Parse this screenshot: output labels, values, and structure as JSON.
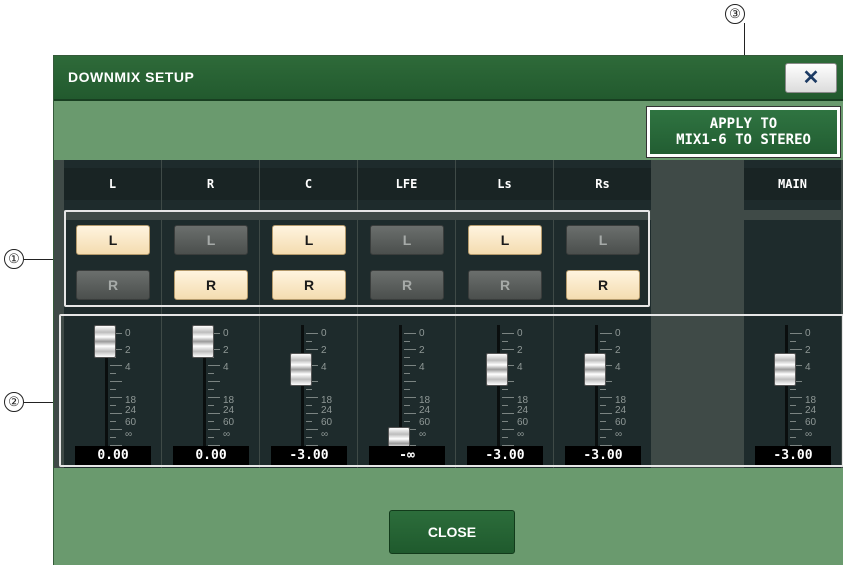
{
  "callouts": [
    "①",
    "②",
    "③"
  ],
  "window": {
    "title": "DOWNMIX SETUP",
    "close_icon": "✕",
    "apply_button": {
      "line1": "APPLY TO",
      "line2": "MIX1-6 TO STEREO"
    },
    "close_button": "CLOSE"
  },
  "scale_labels": [
    "0",
    "2",
    "4",
    "18",
    "24",
    "60",
    "∞"
  ],
  "channels": [
    {
      "name": "L",
      "l": "L",
      "r": "R",
      "l_on": true,
      "r_on": false,
      "value": "0.00",
      "level_db": "0"
    },
    {
      "name": "R",
      "l": "L",
      "r": "R",
      "l_on": false,
      "r_on": true,
      "value": "0.00",
      "level_db": "0"
    },
    {
      "name": "C",
      "l": "L",
      "r": "R",
      "l_on": true,
      "r_on": true,
      "value": "-3.00",
      "level_db": "-3"
    },
    {
      "name": "LFE",
      "l": "L",
      "r": "R",
      "l_on": false,
      "r_on": false,
      "value": "-∞",
      "level_db": "-inf"
    },
    {
      "name": "Ls",
      "l": "L",
      "r": "R",
      "l_on": true,
      "r_on": false,
      "value": "-3.00",
      "level_db": "-3"
    },
    {
      "name": "Rs",
      "l": "L",
      "r": "R",
      "l_on": false,
      "r_on": true,
      "value": "-3.00",
      "level_db": "-3"
    }
  ],
  "main": {
    "name": "MAIN",
    "value": "-3.00",
    "level_db": "-3"
  },
  "colors": {
    "titlebar": "#2a6535",
    "panel": "#6a9a6e",
    "button_on": "#f6e2bb",
    "button_off": "#5b5f5d",
    "column_bg": "#1e2b2c"
  }
}
